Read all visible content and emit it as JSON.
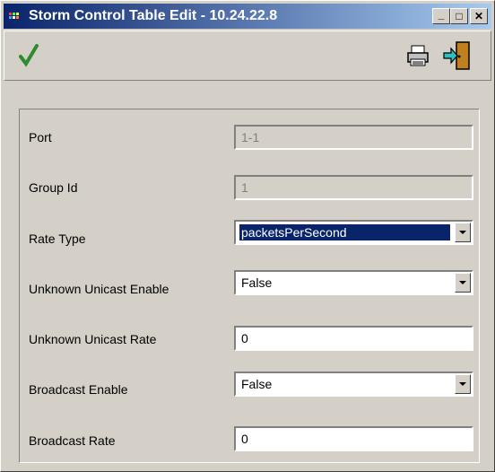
{
  "window": {
    "title": "Storm Control Table Edit - 10.24.22.8",
    "controls": {
      "minimize": "_",
      "maximize": "□",
      "close": "✕"
    }
  },
  "toolbar": {
    "apply_icon": "check-icon",
    "print_icon": "printer-icon",
    "exit_icon": "exit-door-icon"
  },
  "form": {
    "port": {
      "label": "Port",
      "value": "1-1"
    },
    "group_id": {
      "label": "Group Id",
      "value": "1"
    },
    "rate_type": {
      "label": "Rate Type",
      "value": "packetsPerSecond"
    },
    "unknown_unicast_enable": {
      "label": "Unknown Unicast Enable",
      "value": "False"
    },
    "unknown_unicast_rate": {
      "label": "Unknown Unicast Rate",
      "value": "0"
    },
    "broadcast_enable": {
      "label": "Broadcast Enable",
      "value": "False"
    },
    "broadcast_rate": {
      "label": "Broadcast Rate",
      "value": "0"
    }
  },
  "colors": {
    "titlebar_start": "#0a246a",
    "titlebar_end": "#a6caf0",
    "face": "#d4d0c8",
    "check_green": "#2e8b2e"
  }
}
